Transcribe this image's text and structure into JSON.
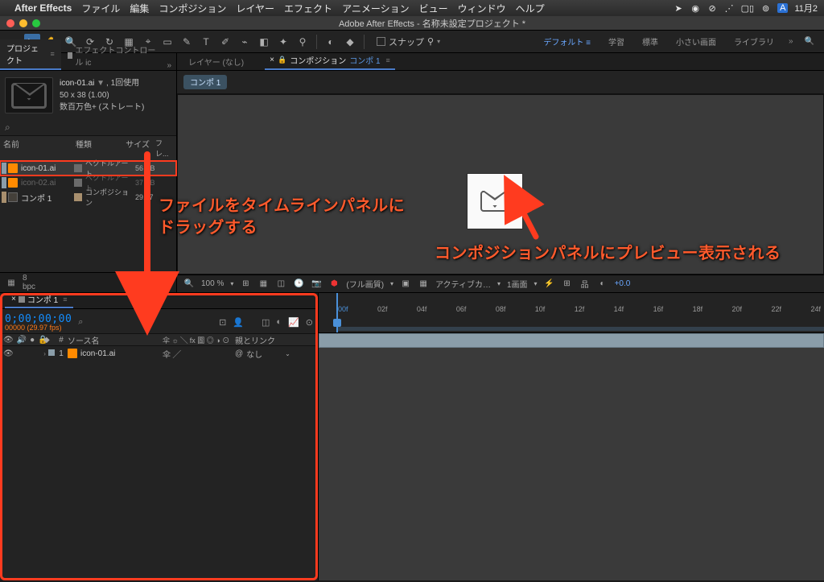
{
  "mac_menu": {
    "app": "After Effects",
    "items": [
      "ファイル",
      "編集",
      "コンポジション",
      "レイヤー",
      "エフェクト",
      "アニメーション",
      "ビュー",
      "ウィンドウ",
      "ヘルプ"
    ],
    "status_battery": "▢▯",
    "status_ime": "A",
    "status_date": "11月2"
  },
  "window_title": "Adobe After Effects - 名称未設定プロジェクト *",
  "toolbar": {
    "snap_label": "スナップ"
  },
  "workspaces": {
    "items": [
      "デフォルト",
      "学習",
      "標準",
      "小さい画面",
      "ライブラリ"
    ],
    "active": 0
  },
  "left_panel": {
    "tabs": {
      "project": "プロジェクト",
      "effects": "エフェクトコントロール ic"
    },
    "asset": {
      "name": "icon-01.ai",
      "used": "1回使用",
      "dims": "50 x 38 (1.00)",
      "colors": "数百万色+ (ストレート)"
    },
    "columns": {
      "name": "名前",
      "type": "種類",
      "size": "サイズ",
      "fr": "フレ..."
    },
    "rows": [
      {
        "name": "icon-01.ai",
        "type": "ベクトルアート",
        "size": "56 KB",
        "kind": "ai",
        "hl": true
      },
      {
        "name": "icon-02.ai",
        "type": "ベクトルアート",
        "size": "37 KB",
        "kind": "ai",
        "hl": false,
        "dim": true
      },
      {
        "name": "コンポ 1",
        "type": "コンポジション",
        "size": "29.97",
        "kind": "comp",
        "hl": false
      }
    ],
    "footer_bpc": "8 bpc"
  },
  "comp_panel": {
    "layer_tab": "レイヤー (なし)",
    "comp_tab_prefix": "コンポジション",
    "comp_tab_name": "コンポ 1",
    "pill": "コンポ 1",
    "footer": {
      "zoom": "100 %",
      "quality": "(フル画質)",
      "camera": "アクティブカ…",
      "views": "1画面",
      "exposure": "+0.0"
    }
  },
  "timeline": {
    "tab": "コンポ 1",
    "timecode": "0;00;00;00",
    "fps": "00000 (29.97 fps)",
    "cols": {
      "src": "ソース名",
      "switches": "伞 ☼ ╲ fx 圖 ◎ ◑ ⊙",
      "parent": "親とリンク"
    },
    "layer1": {
      "num": "1",
      "name": "icon-01.ai",
      "switches": "伞    ╱",
      "parent": "なし"
    },
    "ruler": [
      "00f",
      "02f",
      "04f",
      "06f",
      "08f",
      "10f",
      "12f",
      "14f",
      "16f",
      "18f",
      "20f",
      "22f",
      "24f"
    ]
  },
  "annotations": {
    "a1_line1": "ファイルをタイムラインパネルに",
    "a1_line2": "ドラッグする",
    "a2": "コンポジションパネルにプレビュー表示される"
  }
}
